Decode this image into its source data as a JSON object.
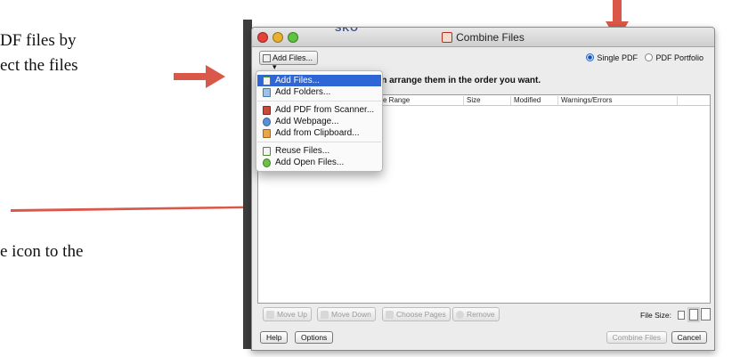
{
  "document": {
    "line1": "DF files by",
    "line2": "ect the files",
    "line3": "e icon to the"
  },
  "window": {
    "title": "Combine Files",
    "behind_text": "SKO"
  },
  "toolbar": {
    "add_files_label": "Add Files...",
    "add_files_caret": "▾",
    "radio_single": "Single PDF",
    "radio_portfolio": "PDF Portfolio",
    "selected": "Single PDF"
  },
  "instructions": "n, and then arrange them in the order you want.",
  "columns": [
    "e Range",
    "Size",
    "Modified",
    "Warnings/Errors"
  ],
  "menu": {
    "items": [
      {
        "label": "Add Files...",
        "icon": "add-files-icon"
      },
      {
        "label": "Add Folders...",
        "icon": "add-folders-icon"
      },
      {
        "label": "Add PDF from Scanner...",
        "icon": "scanner-icon"
      },
      {
        "label": "Add Webpage...",
        "icon": "webpage-icon"
      },
      {
        "label": "Add from Clipboard...",
        "icon": "clipboard-icon"
      },
      {
        "label": "Reuse Files...",
        "icon": "reuse-files-icon"
      },
      {
        "label": "Add Open Files...",
        "icon": "open-files-icon"
      }
    ],
    "highlighted": "Add Files..."
  },
  "bottom": {
    "move_up": "Move Up",
    "move_down": "Move Down",
    "choose_pages": "Choose Pages",
    "remove": "Remove",
    "file_size_label": "File Size:"
  },
  "footer": {
    "help": "Help",
    "options": "Options",
    "combine": "Combine Files",
    "cancel": "Cancel"
  },
  "colors": {
    "arrow": "#d9584a",
    "highlight": "#2f66d6"
  }
}
